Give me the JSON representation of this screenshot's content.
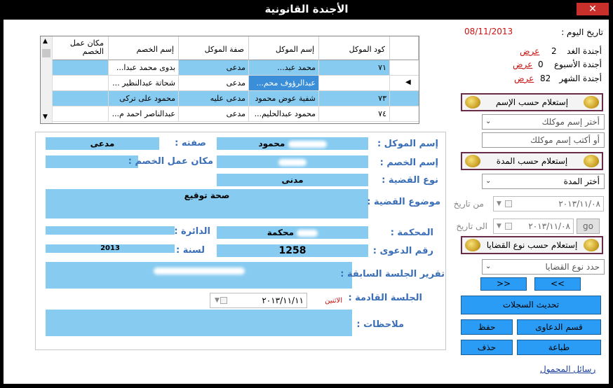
{
  "window": {
    "title": "الأجندة القانونية",
    "close": "✕"
  },
  "grid": {
    "headers": [
      "كود الموكل",
      "إسم الموكل",
      "صفة الموكل",
      "إسم الخصم",
      "مكان عمل الخصم"
    ],
    "rows": [
      [
        "٧١",
        "محمد عبد...",
        "مدعى",
        "بدوى محمد عبدا...",
        ""
      ],
      [
        "",
        "عبدالرؤوف محم...",
        "مدعى",
        "شحاتة عبدالنظير ...",
        ""
      ],
      [
        "٧٣",
        "شفية عوض محمود",
        "مدعى عليه",
        "محمود على تركى",
        ""
      ],
      [
        "٧٤",
        "محمود عبدالحليم...",
        "مدعى",
        "عبدالناصر احمد م...",
        ""
      ]
    ]
  },
  "detail": {
    "labels": {
      "client_name": "إسم الموكل :",
      "role": "صفته :",
      "opponent": "إسم الخصم :",
      "opponent_work": "مكان عمل الخصم :",
      "case_type": "نوع القضية :",
      "case_subject": "موضوع القضية :",
      "court": "المحكمة :",
      "circuit": "الدائرة :",
      "case_number": "رقم الدعوى :",
      "year": "لسنة :",
      "prev_session": "تقرير الجلسة السابقة :",
      "next_session": "الجلسة القادمة :",
      "notes": "ملاحظات :"
    },
    "values": {
      "client_name": "محمود",
      "role": "مدعى",
      "case_type": "مدنى",
      "case_subject": "صحة توقيع",
      "court": "محكمة",
      "case_number": "1258",
      "year": "2013",
      "next_session_date": "٢٠١٣/١١/١١",
      "next_session_day": "الاثنين"
    }
  },
  "right": {
    "today_label": "تاريخ اليوم :",
    "today_value": "08/11/2013",
    "tomorrow_label": "أجندة الغد",
    "tomorrow_count": "2",
    "week_label": "أجندة الأسبوع",
    "week_count": "0",
    "month_label": "أجندة الشهر",
    "month_count": "82",
    "show": "عرض",
    "query_by_name": "إستعلام حسب الإسم",
    "choose_client": "أختر إسم موكلك",
    "type_client": "أو أكتب إسم موكلك",
    "query_by_period": "إستعلام حسب المدة",
    "choose_period": "أختر المدة",
    "from_date": "من تاريخ",
    "to_date": "الى تاريخ",
    "date_value": "٢٠١٣/١١/٠٨",
    "go": "go",
    "query_by_type": "إستعلام حسب نوع القضايا",
    "choose_type": "حدد نوع القضايا",
    "prev": "<<",
    "next": ">>",
    "update": "تحديث السجلات",
    "lawsuits": "قسم الدعاوى",
    "save": "حفظ",
    "print": "طباعة",
    "delete": "حذف",
    "mobile_messages": "رسائل المحمول"
  }
}
